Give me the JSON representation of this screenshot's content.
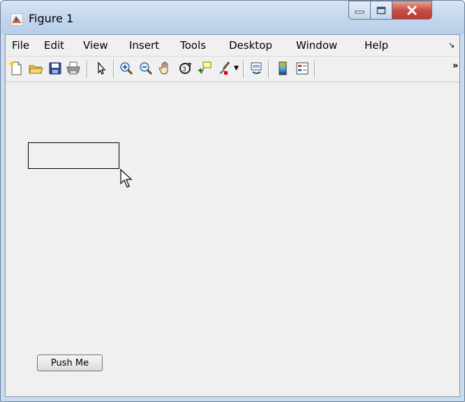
{
  "window": {
    "title": "Figure 1"
  },
  "menubar": {
    "items": [
      "File",
      "Edit",
      "View",
      "Insert",
      "Tools",
      "Desktop",
      "Window",
      "Help"
    ]
  },
  "toolbar": {
    "tools": [
      "new-figure",
      "open-file",
      "save-figure",
      "print-figure",
      "edit-plot",
      "zoom-in",
      "zoom-out",
      "pan",
      "rotate-3d",
      "data-cursor",
      "brush",
      "brush-dropdown",
      "link-plot",
      "insert-colorbar",
      "insert-legend"
    ]
  },
  "canvas": {
    "push_button_label": "Push Me"
  },
  "colors": {
    "title_bar": "#c8dbef",
    "close_button": "#c75048",
    "client_background": "#f0f0f0"
  }
}
